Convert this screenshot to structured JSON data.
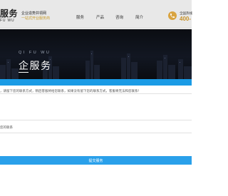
{
  "header": {
    "logo_main": "服务",
    "logo_sub": "FU WU",
    "tagline_line1": "企业造势井领网",
    "tagline_line2": "一站式开业服务商",
    "nav": [
      "服务",
      "产品",
      "咨询",
      "简介"
    ],
    "hotline_label": "全国热线",
    "hotline_number": "400-"
  },
  "banner": {
    "subtitle": "QI FU WU",
    "title": "企服务"
  },
  "form": {
    "notice": "，请留下您的联系方式，稍后客服将给您联系，如果没有留下您的联系方式，客服将无法和您联系！",
    "field_label": "您的联系",
    "submit_label": "提交服务"
  },
  "colors": {
    "header_bg": "#e8e8e8",
    "accent_gold": "#c7922a",
    "brand_blue": "#1a9be5",
    "banner_bg": "#0f131b"
  }
}
